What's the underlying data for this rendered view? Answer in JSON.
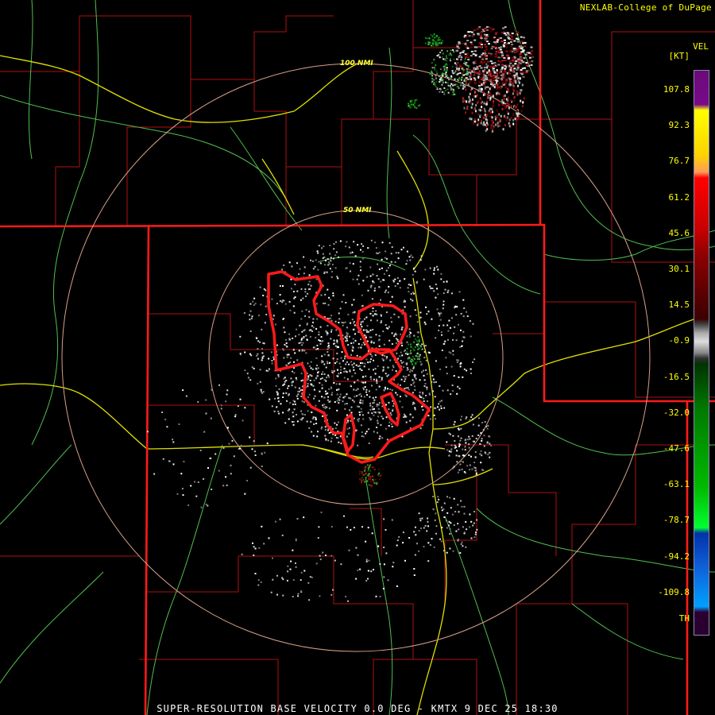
{
  "header": {
    "credit": "NEXLAB-College of DuPage"
  },
  "footer": {
    "caption": "SUPER-RESOLUTION BASE VELOCITY 0.0 DEG - KMTX 9 DEC 25 18:30"
  },
  "legend": {
    "product": "VEL",
    "unit": "[KT]",
    "ticks": [
      "107.8",
      "92.3",
      "76.7",
      "61.2",
      "45.6",
      "30.1",
      "14.5",
      "-0.9",
      "-16.5",
      "-32.0",
      "-47.6",
      "-63.1",
      "-78.7",
      "-94.2",
      "-109.8",
      "TH"
    ]
  },
  "range_rings": {
    "inner_label": "50 NMI",
    "outer_label": "100 NMI"
  },
  "colors": {
    "state_lines": "#ff1a1a",
    "county_lines": "#bb1111",
    "highways": "#e6e600",
    "roads": "#5ecf5e",
    "rings": "#d8a08a",
    "warning_polygon": "#ff1a1a",
    "text": "#ffff00"
  }
}
